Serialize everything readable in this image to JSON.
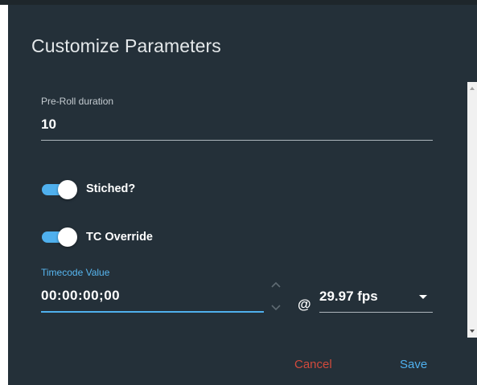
{
  "dialog": {
    "title": "Customize Parameters"
  },
  "preroll": {
    "label": "Pre-Roll duration",
    "value": "10"
  },
  "stitched": {
    "label": "Stiched?",
    "checked": true
  },
  "tc_override": {
    "label": "TC Override",
    "checked": true
  },
  "timecode": {
    "label": "Timecode Value",
    "value": "00:00:00;00",
    "separator": "@",
    "fps": "29.97 fps"
  },
  "actions": {
    "cancel": "Cancel",
    "save": "Save"
  },
  "colors": {
    "background": "#243039",
    "accent": "#4fb0ee",
    "cancel": "#d14a3c"
  },
  "icons": {
    "spinner_up": "chevron-up-icon",
    "spinner_down": "chevron-down-icon",
    "select_caret": "caret-down-icon"
  }
}
